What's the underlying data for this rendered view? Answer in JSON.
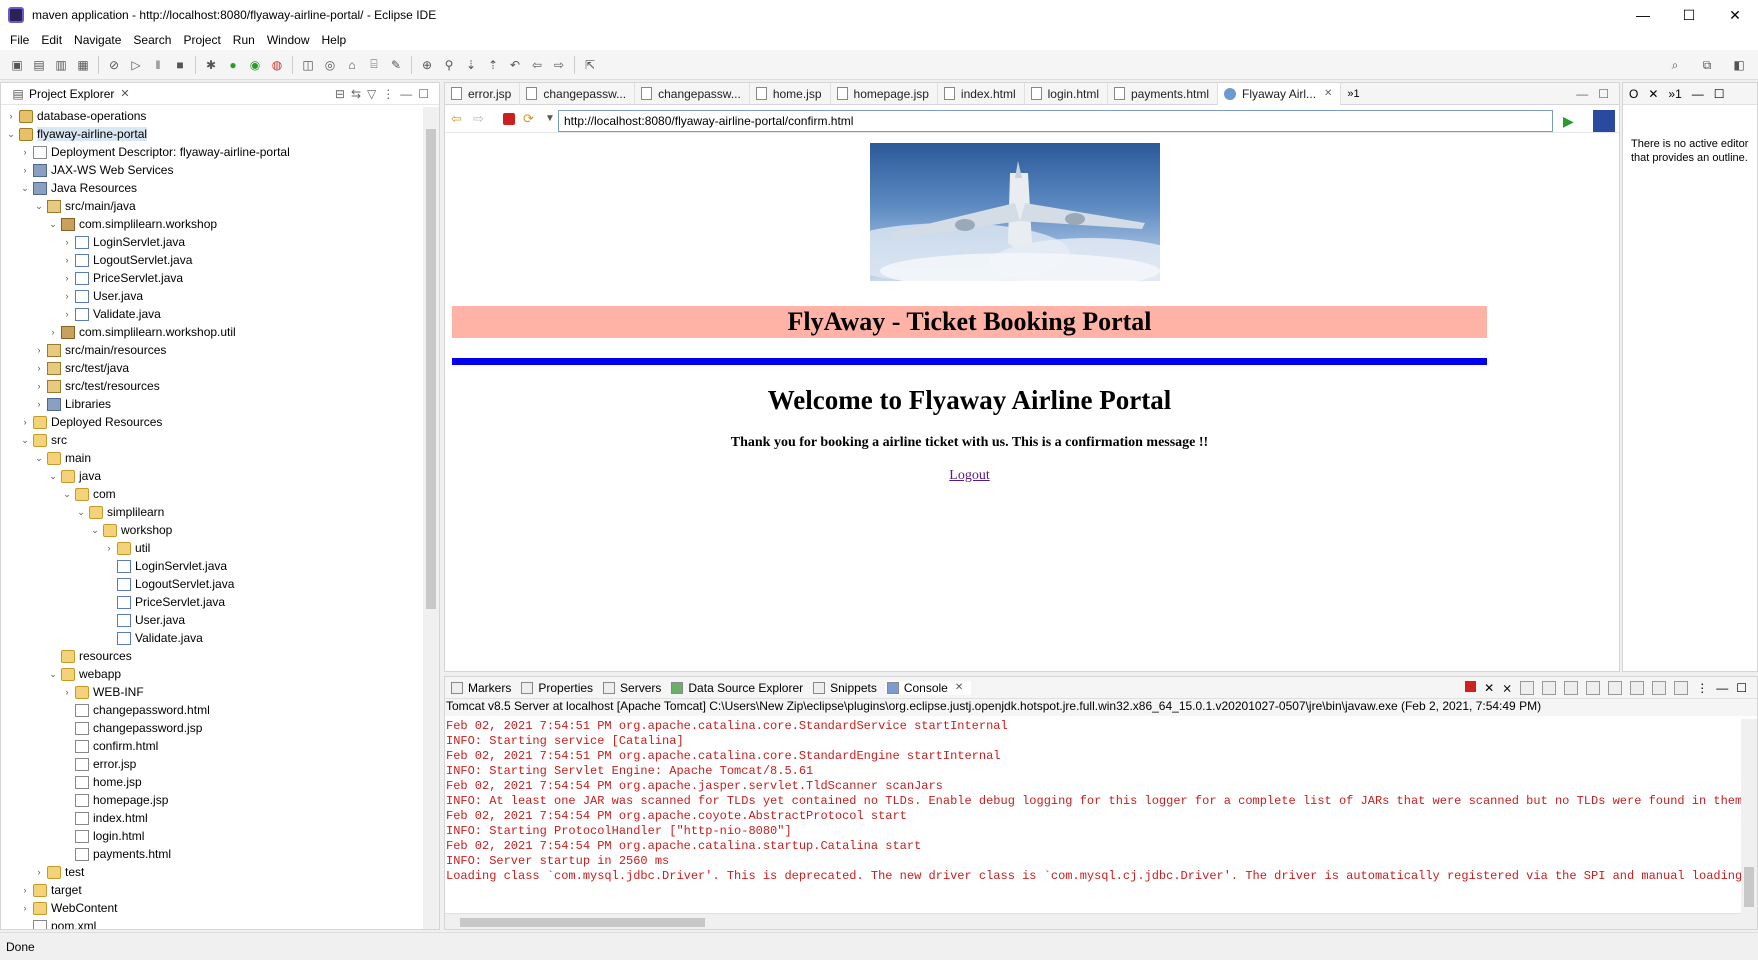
{
  "window": {
    "title": "maven application - http://localhost:8080/flyaway-airline-portal/ - Eclipse IDE",
    "minimize": "—",
    "maximize": "☐",
    "close": "✕"
  },
  "menu": [
    "File",
    "Edit",
    "Navigate",
    "Search",
    "Project",
    "Run",
    "Window",
    "Help"
  ],
  "project_explorer": {
    "title": "Project Explorer",
    "tree": [
      {
        "label": "database-operations",
        "depth": 0,
        "arrow": "›",
        "icon": "proj"
      },
      {
        "label": "flyaway-airline-portal",
        "depth": 0,
        "arrow": "⌄",
        "icon": "proj",
        "selected": true
      },
      {
        "label": "Deployment Descriptor: flyaway-airline-portal",
        "depth": 1,
        "arrow": "›",
        "icon": "file"
      },
      {
        "label": "JAX-WS Web Services",
        "depth": 1,
        "arrow": "›",
        "icon": "lib"
      },
      {
        "label": "Java Resources",
        "depth": 1,
        "arrow": "⌄",
        "icon": "lib"
      },
      {
        "label": "src/main/java",
        "depth": 2,
        "arrow": "⌄",
        "icon": "srcf"
      },
      {
        "label": "com.simplilearn.workshop",
        "depth": 3,
        "arrow": "⌄",
        "icon": "pkg"
      },
      {
        "label": "LoginServlet.java",
        "depth": 4,
        "arrow": "›",
        "icon": "java"
      },
      {
        "label": "LogoutServlet.java",
        "depth": 4,
        "arrow": "›",
        "icon": "java"
      },
      {
        "label": "PriceServlet.java",
        "depth": 4,
        "arrow": "›",
        "icon": "java"
      },
      {
        "label": "User.java",
        "depth": 4,
        "arrow": "›",
        "icon": "java"
      },
      {
        "label": "Validate.java",
        "depth": 4,
        "arrow": "›",
        "icon": "java"
      },
      {
        "label": "com.simplilearn.workshop.util",
        "depth": 3,
        "arrow": "›",
        "icon": "pkg"
      },
      {
        "label": "src/main/resources",
        "depth": 2,
        "arrow": "›",
        "icon": "srcf"
      },
      {
        "label": "src/test/java",
        "depth": 2,
        "arrow": "›",
        "icon": "srcf"
      },
      {
        "label": "src/test/resources",
        "depth": 2,
        "arrow": "›",
        "icon": "srcf"
      },
      {
        "label": "Libraries",
        "depth": 2,
        "arrow": "›",
        "icon": "lib"
      },
      {
        "label": "Deployed Resources",
        "depth": 1,
        "arrow": "›",
        "icon": "folder"
      },
      {
        "label": "src",
        "depth": 1,
        "arrow": "⌄",
        "icon": "folder"
      },
      {
        "label": "main",
        "depth": 2,
        "arrow": "⌄",
        "icon": "folder"
      },
      {
        "label": "java",
        "depth": 3,
        "arrow": "⌄",
        "icon": "folder"
      },
      {
        "label": "com",
        "depth": 4,
        "arrow": "⌄",
        "icon": "folder"
      },
      {
        "label": "simplilearn",
        "depth": 5,
        "arrow": "⌄",
        "icon": "folder"
      },
      {
        "label": "workshop",
        "depth": 6,
        "arrow": "⌄",
        "icon": "folder"
      },
      {
        "label": "util",
        "depth": 7,
        "arrow": "›",
        "icon": "folder"
      },
      {
        "label": "LoginServlet.java",
        "depth": 7,
        "arrow": "",
        "icon": "java"
      },
      {
        "label": "LogoutServlet.java",
        "depth": 7,
        "arrow": "",
        "icon": "java"
      },
      {
        "label": "PriceServlet.java",
        "depth": 7,
        "arrow": "",
        "icon": "java"
      },
      {
        "label": "User.java",
        "depth": 7,
        "arrow": "",
        "icon": "java"
      },
      {
        "label": "Validate.java",
        "depth": 7,
        "arrow": "",
        "icon": "java"
      },
      {
        "label": "resources",
        "depth": 3,
        "arrow": "",
        "icon": "folder"
      },
      {
        "label": "webapp",
        "depth": 3,
        "arrow": "⌄",
        "icon": "folder"
      },
      {
        "label": "WEB-INF",
        "depth": 4,
        "arrow": "›",
        "icon": "folder"
      },
      {
        "label": "changepassword.html",
        "depth": 4,
        "arrow": "",
        "icon": "file"
      },
      {
        "label": "changepassword.jsp",
        "depth": 4,
        "arrow": "",
        "icon": "file"
      },
      {
        "label": "confirm.html",
        "depth": 4,
        "arrow": "",
        "icon": "file"
      },
      {
        "label": "error.jsp",
        "depth": 4,
        "arrow": "",
        "icon": "file"
      },
      {
        "label": "home.jsp",
        "depth": 4,
        "arrow": "",
        "icon": "file"
      },
      {
        "label": "homepage.jsp",
        "depth": 4,
        "arrow": "",
        "icon": "file"
      },
      {
        "label": "index.html",
        "depth": 4,
        "arrow": "",
        "icon": "file"
      },
      {
        "label": "login.html",
        "depth": 4,
        "arrow": "",
        "icon": "file"
      },
      {
        "label": "payments.html",
        "depth": 4,
        "arrow": "",
        "icon": "file"
      },
      {
        "label": "test",
        "depth": 2,
        "arrow": "›",
        "icon": "folder"
      },
      {
        "label": "target",
        "depth": 1,
        "arrow": "›",
        "icon": "folder"
      },
      {
        "label": "WebContent",
        "depth": 1,
        "arrow": "›",
        "icon": "folder"
      },
      {
        "label": "pom.xml",
        "depth": 1,
        "arrow": "",
        "icon": "file"
      }
    ]
  },
  "editor": {
    "tabs": [
      {
        "label": "error.jsp"
      },
      {
        "label": "changepassw..."
      },
      {
        "label": "changepassw..."
      },
      {
        "label": "home.jsp"
      },
      {
        "label": "homepage.jsp"
      },
      {
        "label": "index.html"
      },
      {
        "label": "login.html"
      },
      {
        "label": "payments.html"
      },
      {
        "label": "Flyaway Airl...",
        "active": true
      }
    ],
    "more_tabs": "»1",
    "url": "http://localhost:8080/flyaway-airline-portal/confirm.html",
    "page": {
      "banner": "FlyAway - Ticket Booking Portal",
      "welcome": "Welcome to Flyaway Airline Portal",
      "message": "Thank you for booking a airline ticket with us. This is a confirmation message !!",
      "logout_link": "Logout"
    }
  },
  "outline": {
    "message": "There is no active editor that provides an outline."
  },
  "console_panel": {
    "tabs": [
      {
        "label": "Markers"
      },
      {
        "label": "Properties"
      },
      {
        "label": "Servers"
      },
      {
        "label": "Data Source Explorer"
      },
      {
        "label": "Snippets"
      },
      {
        "label": "Console",
        "active": true
      }
    ],
    "server_line": "Tomcat v8.5 Server at localhost [Apache Tomcat] C:\\Users\\New Zip\\eclipse\\plugins\\org.eclipse.justj.openjdk.hotspot.jre.full.win32.x86_64_15.0.1.v20201027-0507\\jre\\bin\\javaw.exe  (Feb 2, 2021, 7:54:49 PM)",
    "lines": [
      "Feb 02, 2021 7:54:51 PM org.apache.catalina.core.StandardService startInternal",
      "INFO: Starting service [Catalina]",
      "Feb 02, 2021 7:54:51 PM org.apache.catalina.core.StandardEngine startInternal",
      "INFO: Starting Servlet Engine: Apache Tomcat/8.5.61",
      "Feb 02, 2021 7:54:54 PM org.apache.jasper.servlet.TldScanner scanJars",
      "INFO: At least one JAR was scanned for TLDs yet contained no TLDs. Enable debug logging for this logger for a complete list of JARs that were scanned but no TLDs were found in them. Ski",
      "Feb 02, 2021 7:54:54 PM org.apache.coyote.AbstractProtocol start",
      "INFO: Starting ProtocolHandler [\"http-nio-8080\"]",
      "Feb 02, 2021 7:54:54 PM org.apache.catalina.startup.Catalina start",
      "INFO: Server startup in 2560 ms",
      "Loading class `com.mysql.jdbc.Driver'. This is deprecated. The new driver class is `com.mysql.cj.jdbc.Driver'. The driver is automatically registered via the SPI and manual loading of t"
    ]
  },
  "status": {
    "text": "Done"
  },
  "colors": {
    "banner_bg": "#ffb3a6",
    "rule": "#0000ee",
    "log_text": "#c81e1e",
    "visited_link": "#551a8b"
  }
}
